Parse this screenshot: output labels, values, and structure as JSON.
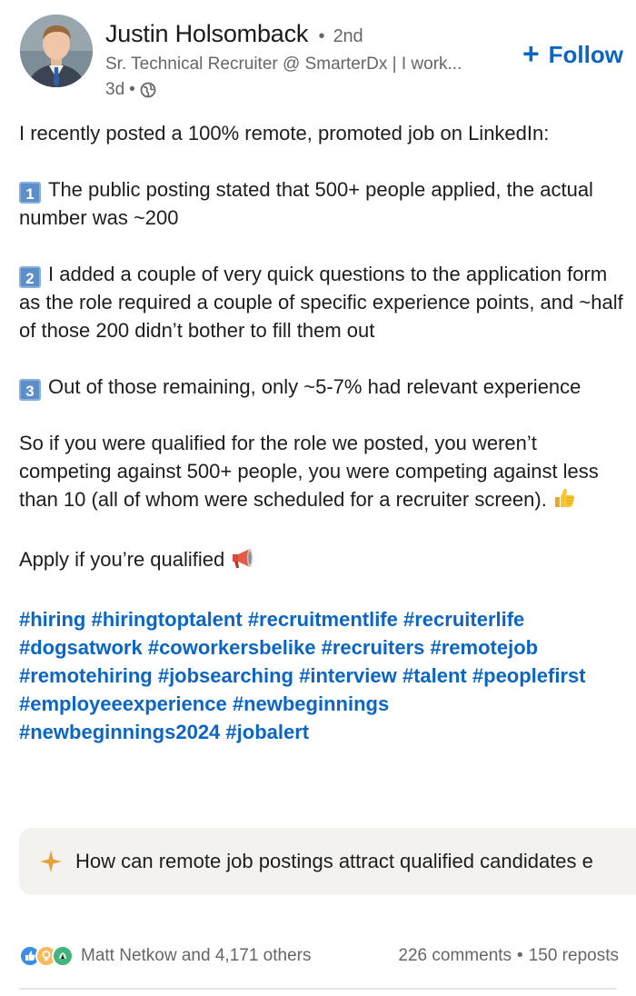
{
  "author": {
    "name": "Justin Holsomback",
    "separator": "•",
    "degree": "2nd",
    "headline": "Sr. Technical Recruiter @ SmarterDx | I work...",
    "time": "3d",
    "time_separator": "•",
    "visibility_icon": "globe-icon"
  },
  "follow": {
    "icon": "plus-icon",
    "label": "Follow"
  },
  "post": {
    "intro": "I recently posted a 100% remote, promoted job on LinkedIn:",
    "points": [
      {
        "key": "1",
        "text": "The public posting stated that 500+ people applied, the actual number was ~200"
      },
      {
        "key": "2",
        "text": "I added a couple of very quick questions to the application form as the role required a couple of specific experience points, and ~half of those 200 didn’t bother to fill them out"
      },
      {
        "key": "3",
        "text": "Out of those remaining, only ~5-7% had relevant experience"
      }
    ],
    "conclusion": "So if you were qualified for the role we posted, you weren’t competing against 500+ people, you were competing against less than 10 (all of whom were scheduled for a recruiter screen).",
    "conclusion_emoji": "thumbs-up-icon",
    "cta": "Apply if you’re qualified",
    "cta_emoji": "megaphone-icon",
    "hashtags": [
      "#hiring",
      "#hiringtoptalent",
      "#recruitmentlife",
      "#recruiterlife",
      "#dogsatwork",
      "#coworkersbelike",
      "#recruiters",
      "#remotejob",
      "#remotehiring",
      "#jobsearching",
      "#interview",
      "#talent",
      "#peoplefirst",
      "#employeeexperience",
      "#newbeginnings",
      "#newbeginnings2024",
      "#jobalert"
    ]
  },
  "ai_prompt": {
    "icon": "sparkle-icon",
    "text": "How can remote job postings attract qualified candidates e"
  },
  "social": {
    "reaction_icons": [
      "like-icon",
      "insightful-icon",
      "celebrate-icon"
    ],
    "reactors": "Matt Netkow and 4,171 others",
    "comments": "226 comments",
    "separator": "•",
    "reposts": "150 reposts"
  },
  "colors": {
    "link": "#0a66c2",
    "muted": "#666666",
    "ai_box_bg": "#f3f2ef",
    "key_bg": "#5c8ec9"
  }
}
